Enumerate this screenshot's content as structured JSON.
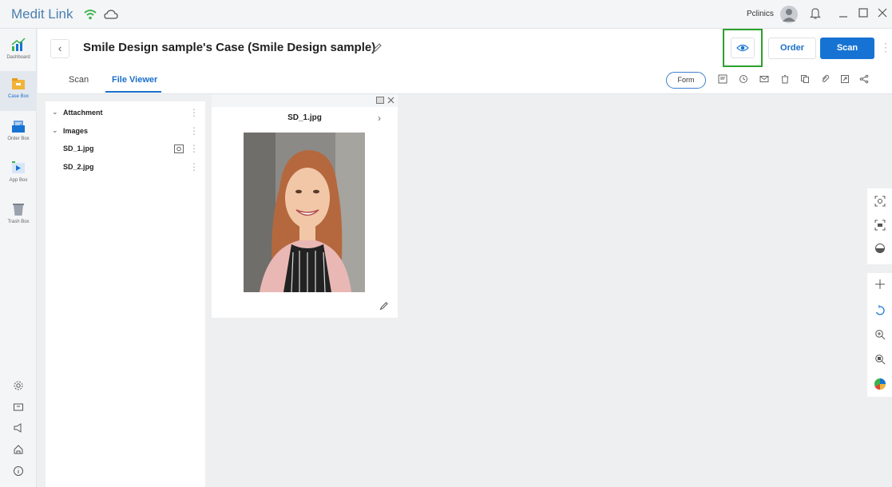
{
  "app": {
    "brand": "Medit Link",
    "user_name": "Pclinics",
    "icons": [
      "wifi-icon",
      "cloud-icon",
      "avatar",
      "bell-icon",
      "minimize-icon",
      "maximize-icon",
      "close-icon"
    ]
  },
  "sidebar": {
    "items": [
      {
        "label": "Dashboard",
        "icon": "dashboard-icon"
      },
      {
        "label": "Case Box",
        "icon": "case-box-icon"
      },
      {
        "label": "Order Box",
        "icon": "order-box-icon"
      },
      {
        "label": "App Box",
        "icon": "app-box-icon"
      },
      {
        "label": "Trash Box",
        "icon": "trash-box-icon"
      }
    ],
    "bottom_icons": [
      "settings-icon",
      "folder-icon",
      "announcement-icon",
      "home-icon",
      "info-icon"
    ],
    "active": "Case Box"
  },
  "header": {
    "back": "‹",
    "title": "Smile Design sample's Case (Smile Design sample)",
    "order_label": "Order",
    "scan_label": "Scan"
  },
  "tabs": {
    "items": [
      "Scan",
      "File Viewer"
    ],
    "active": "File Viewer",
    "form_label": "Form"
  },
  "tree": {
    "attachment": "Attachment",
    "images": "Images",
    "files": [
      "SD_1.jpg",
      "SD_2.jpg"
    ]
  },
  "viewer": {
    "file_name": "SD_1.jpg"
  },
  "colors": {
    "accent": "#1673d3",
    "highlight": "#2aa12a"
  }
}
